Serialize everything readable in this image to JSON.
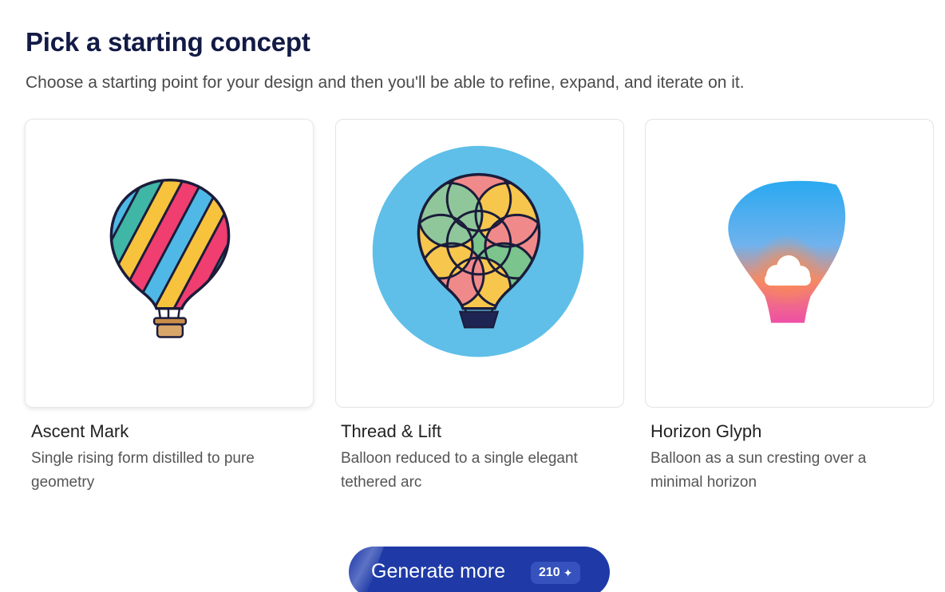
{
  "header": {
    "title": "Pick a starting concept",
    "subtitle": "Choose a starting point for your design and then you'll be able to refine, expand, and iterate on it."
  },
  "concepts": [
    {
      "name": "Ascent Mark",
      "description": "Single rising form distilled to pure geometry",
      "icon": "striped-hot-air-balloon-icon"
    },
    {
      "name": "Thread & Lift",
      "description": "Balloon reduced to a single elegant tethered arc",
      "icon": "floral-hot-air-balloon-icon"
    },
    {
      "name": "Horizon Glyph",
      "description": "Balloon as a sun cresting over a minimal horizon",
      "icon": "gradient-balloon-cloud-icon"
    }
  ],
  "generate": {
    "label": "Generate more",
    "credits": "210",
    "credit_icon": "sparkle-icon"
  },
  "colors": {
    "heading": "#121a45",
    "button": "#1f3aa6",
    "card_border": "#e3e3e3",
    "sky_circle": "#5fbfe8"
  }
}
